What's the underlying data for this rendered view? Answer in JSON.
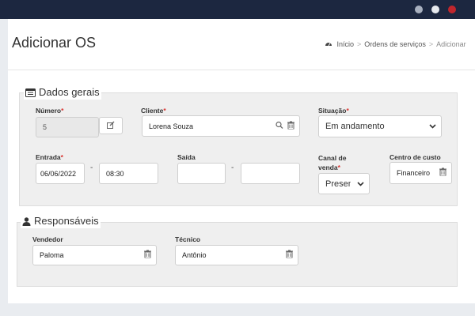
{
  "window": {
    "title": ""
  },
  "page": {
    "title": "Adicionar OS"
  },
  "breadcrumb": {
    "home": "Início",
    "orders": "Ordens de serviços",
    "current": "Adicionar"
  },
  "sections": {
    "general": {
      "title": "Dados gerais"
    },
    "responsible": {
      "title": "Responsáveis"
    }
  },
  "form": {
    "numero": {
      "label": "Número",
      "value": "5"
    },
    "cliente": {
      "label": "Cliente",
      "value": "Lorena Souza"
    },
    "situacao": {
      "label": "Situação",
      "value": "Em andamento"
    },
    "entrada": {
      "label": "Entrada",
      "date": "06/06/2022",
      "time": "08:30"
    },
    "saida": {
      "label": "Saída",
      "date": "",
      "time": ""
    },
    "canal": {
      "label_1": "Canal de",
      "label_2": "venda",
      "value": "Presencial"
    },
    "centro": {
      "label": "Centro de custo",
      "value": "Financeiro"
    },
    "vendedor": {
      "label": "Vendedor",
      "value": "Paloma"
    },
    "tecnico": {
      "label": "Técnico",
      "value": "Antônio"
    }
  },
  "colors": {
    "titlebar": "#1c2740",
    "required": "#d9302c",
    "panel": "#efefef"
  }
}
